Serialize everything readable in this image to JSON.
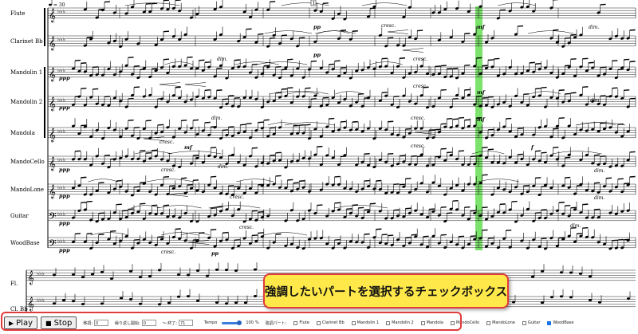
{
  "tempo_marking": "= 30",
  "parts": [
    {
      "name": "Flute"
    },
    {
      "name": "Clarinet Bb"
    },
    {
      "name": "Mandolin 1"
    },
    {
      "name": "Mandolin 2"
    },
    {
      "name": "Mandola"
    },
    {
      "name": "MandoCello"
    },
    {
      "name": "MandoLone"
    },
    {
      "name": "Guitar"
    },
    {
      "name": "WoodBase"
    }
  ],
  "lower_system_parts": [
    "Fl.",
    "Cl. Bb"
  ],
  "dynamics": {
    "ppp": "ppp",
    "pp": "pp",
    "mf": "mf",
    "f": "f",
    "cresc": "cresc.",
    "dim": "dim."
  },
  "rehearsal_mark": "1",
  "callout": "強調したいパートを選択するチェックボックス",
  "controls": {
    "play_label": "Play",
    "stop_label": "Stop",
    "key_label": "移調:",
    "key_value": "0",
    "repeat_start_label": "繰り返し開始:",
    "repeat_start_value": "0",
    "repeat_end_label": "〜 終了:",
    "repeat_end_value": "71",
    "tempo_label": "Tempo",
    "tempo_value": 100,
    "tempo_unit": "%",
    "highlight_label": "強調パート:",
    "checkboxes": [
      {
        "label": "Flute",
        "checked": false
      },
      {
        "label": "Clarinet Bb",
        "checked": false
      },
      {
        "label": "Mandolin 1",
        "checked": false
      },
      {
        "label": "Mandolin 2",
        "checked": false
      },
      {
        "label": "Mandola",
        "checked": false
      },
      {
        "label": "MandoCello",
        "checked": false
      },
      {
        "label": "MandoLone",
        "checked": false
      },
      {
        "label": "Guitar",
        "checked": false
      },
      {
        "label": "WoodBase",
        "checked": true
      }
    ]
  },
  "colors": {
    "playhead": "#7be36b",
    "callout_fill": "#ffe94a",
    "callout_border": "#e13b3b",
    "checkbox_on": "#1a73e8"
  }
}
